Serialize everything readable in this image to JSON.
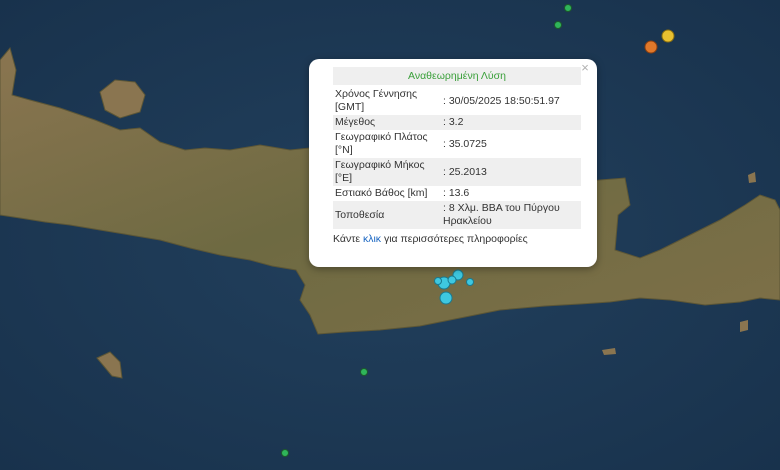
{
  "popup": {
    "title": "Αναθεωρημένη Λύση",
    "close_label": "×",
    "rows": [
      {
        "label": "Χρόνος Γέννησης [GMT]",
        "value": ": 30/05/2025 18:50:51.97"
      },
      {
        "label": "Μέγεθος",
        "value": ": 3.2"
      },
      {
        "label": "Γεωγραφικό Πλάτος [°N]",
        "value": ": 35.0725"
      },
      {
        "label": "Γεωγραφικό Μήκος [°E]",
        "value": ": 25.2013"
      },
      {
        "label": "Εστιακό Βάθος [km]",
        "value": ": 13.6"
      },
      {
        "label": "Τοποθεσία",
        "value": ": 8 Χλμ. ΒΒΑ του Πύργου Ηρακλείου"
      }
    ],
    "more_prefix": "Κάντε ",
    "more_link": "κλικ",
    "more_suffix": " για περισσότερες πληροφορίες"
  },
  "colors": {
    "sea": "#1d3a55",
    "land": "#7a6a45",
    "quake_recent": "#3ec8e0",
    "quake_green": "#2fb55a",
    "quake_orange": "#e0782a",
    "quake_yellow": "#e8c030"
  }
}
